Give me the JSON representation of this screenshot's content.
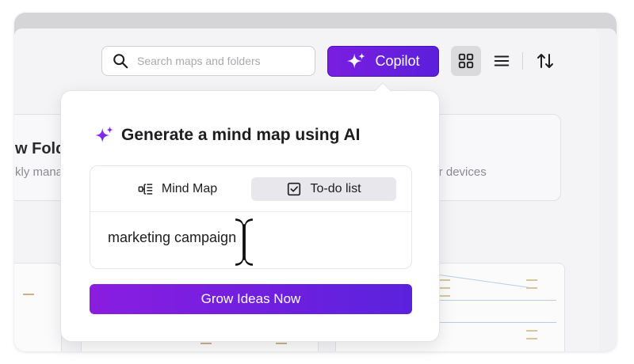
{
  "search": {
    "placeholder": "Search maps and folders"
  },
  "toolbar": {
    "copilot_label": "Copilot",
    "view_grid_icon": "grid-icon",
    "view_list_icon": "list-icon",
    "sort_icon": "sort-icon",
    "accent_color": "#6a1fe0"
  },
  "background": {
    "left_card_title": "w Fold",
    "left_card_sub": "kly mana",
    "right_card_sub": "our devices"
  },
  "popup": {
    "title": "Generate a mind map using AI",
    "title_icon": "sparkle-icon",
    "tabs": [
      {
        "label": "Mind Map",
        "icon": "mind-map-icon",
        "selected": false
      },
      {
        "label": "To-do list",
        "icon": "checkbox-icon",
        "selected": true
      }
    ],
    "prompt_value": "marketing campaign",
    "submit_label": "Grow Ideas Now"
  }
}
